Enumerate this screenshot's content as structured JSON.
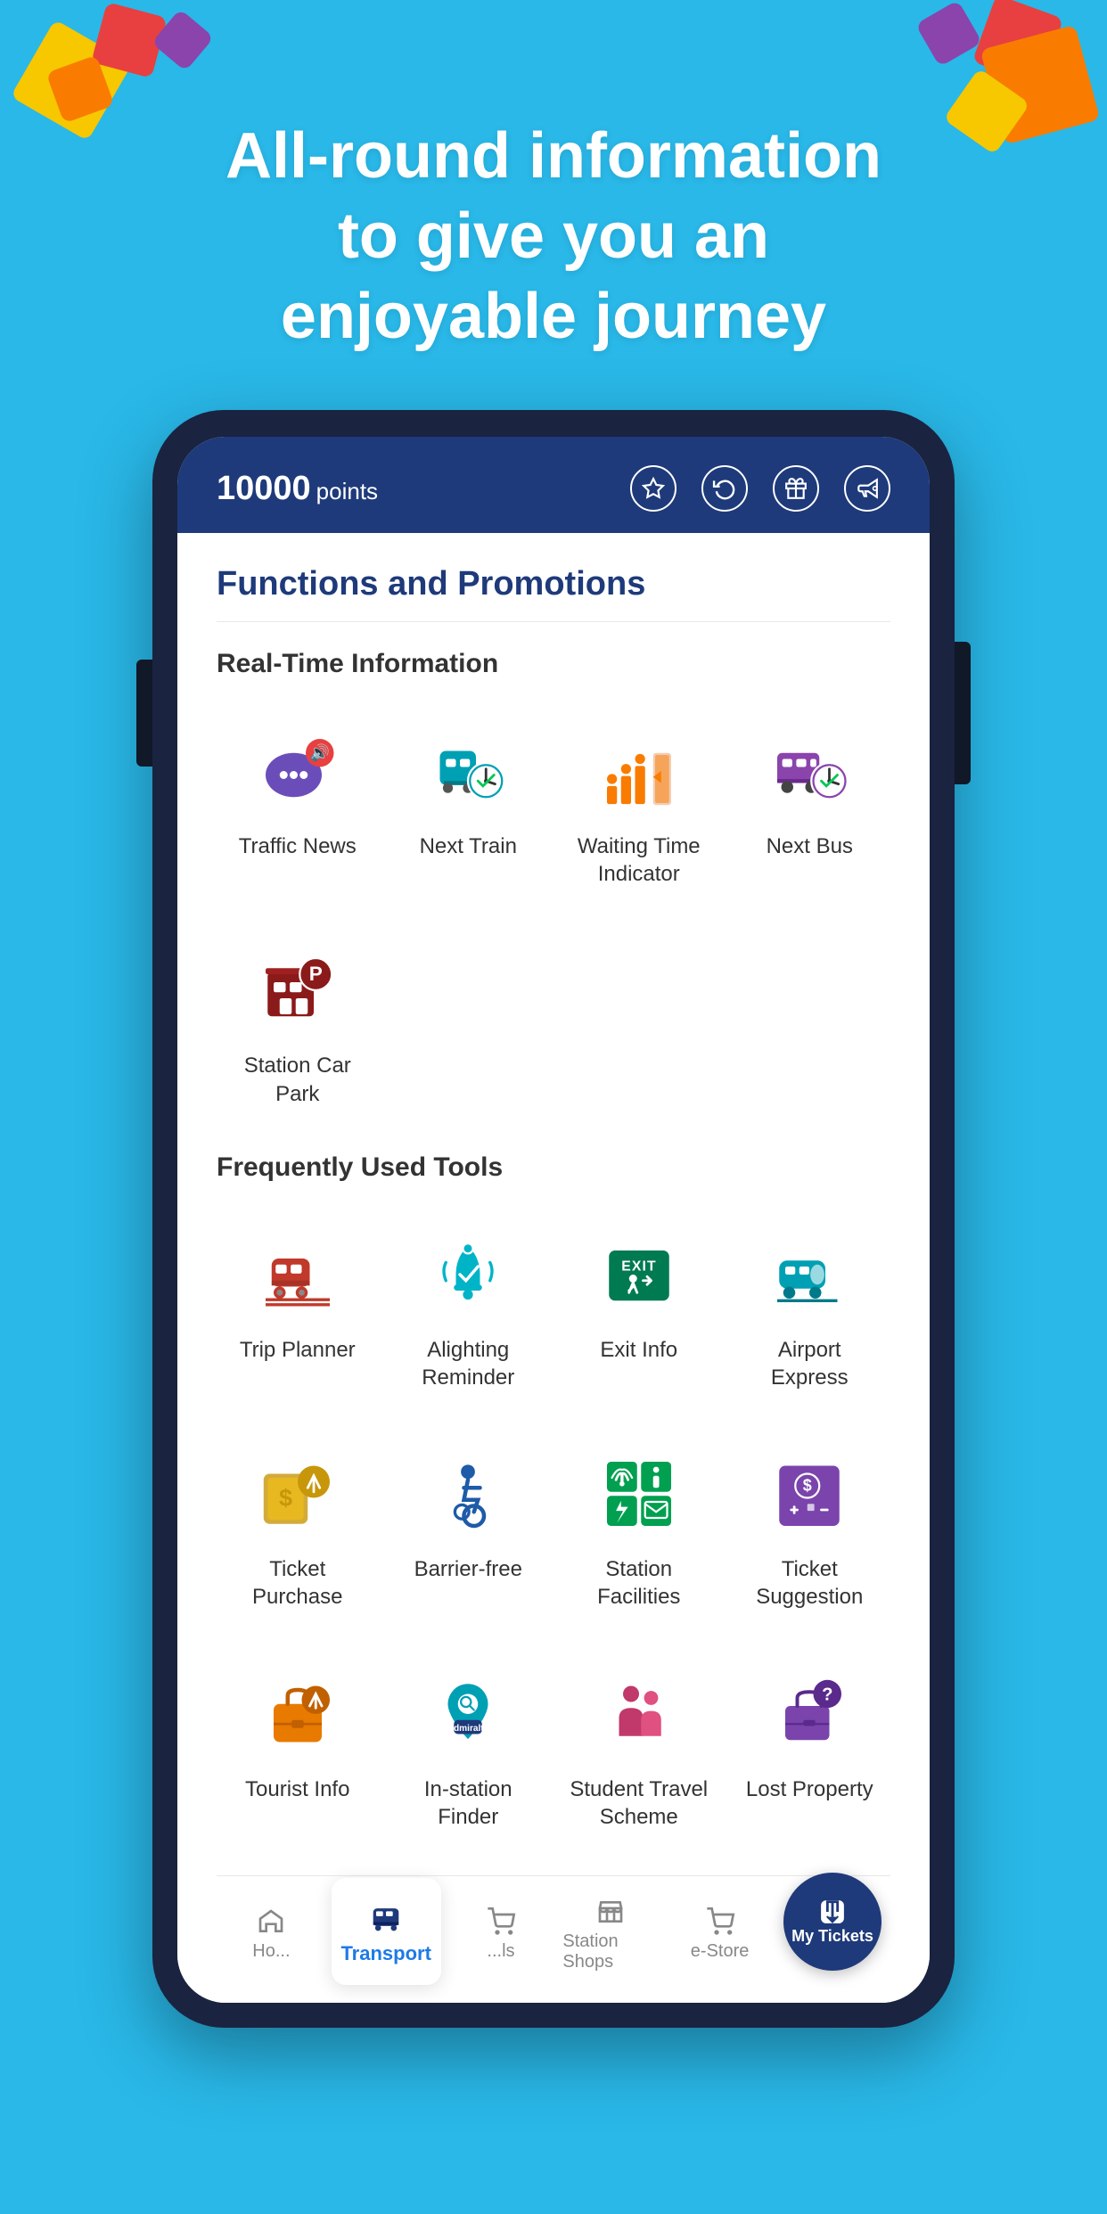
{
  "hero": {
    "line1": "All-round information",
    "line2": "to give you an",
    "line3": "enjoyable journey"
  },
  "phone": {
    "points": "10000",
    "points_label": "points",
    "header_icons": [
      "star",
      "refresh",
      "gift",
      "megaphone"
    ]
  },
  "functions": {
    "title": "Functions and Promotions",
    "sections": [
      {
        "label": "Real-Time Information",
        "items": [
          {
            "id": "traffic-news",
            "label": "Traffic News",
            "icon": "traffic"
          },
          {
            "id": "next-train",
            "label": "Next Train",
            "icon": "train"
          },
          {
            "id": "waiting-time",
            "label": "Waiting Time Indicator",
            "icon": "waiting"
          },
          {
            "id": "next-bus",
            "label": "Next Bus",
            "icon": "bus"
          }
        ]
      },
      {
        "label": "",
        "items": [
          {
            "id": "station-car-park",
            "label": "Station Car Park",
            "icon": "carpark"
          }
        ]
      },
      {
        "label": "Frequently Used Tools",
        "items": [
          {
            "id": "trip-planner",
            "label": "Trip Planner",
            "icon": "tripplanner"
          },
          {
            "id": "alighting-reminder",
            "label": "Alighting Reminder",
            "icon": "alighting"
          },
          {
            "id": "exit-info",
            "label": "Exit Info",
            "icon": "exit"
          },
          {
            "id": "airport-express",
            "label": "Airport Express",
            "icon": "airport"
          }
        ]
      },
      {
        "label": "",
        "items": [
          {
            "id": "ticket-purchase",
            "label": "Ticket Purchase",
            "icon": "ticket"
          },
          {
            "id": "barrier-free",
            "label": "Barrier-free",
            "icon": "barrier"
          },
          {
            "id": "station-facilities",
            "label": "Station Facilities",
            "icon": "facilities"
          },
          {
            "id": "ticket-suggestion",
            "label": "Ticket Suggestion",
            "icon": "suggestion"
          }
        ]
      },
      {
        "label": "",
        "items": [
          {
            "id": "tourist-info",
            "label": "Tourist Info",
            "icon": "tourist"
          },
          {
            "id": "instation-finder",
            "label": "In-station Finder",
            "icon": "finder"
          },
          {
            "id": "student-travel",
            "label": "Student Travel Scheme",
            "icon": "student"
          },
          {
            "id": "lost-property",
            "label": "Lost Property",
            "icon": "lost"
          }
        ]
      }
    ]
  },
  "bottom_nav": [
    {
      "id": "home",
      "label": "Ho...",
      "icon": "home"
    },
    {
      "id": "transport",
      "label": "Transport",
      "icon": "transport",
      "active": true
    },
    {
      "id": "deals",
      "label": "...ls",
      "icon": "deals"
    },
    {
      "id": "station-shops",
      "label": "Station Shops",
      "icon": "shops"
    },
    {
      "id": "e-store",
      "label": "e-Store",
      "icon": "estore"
    },
    {
      "id": "my-tickets",
      "label": "My Tickets",
      "icon": "mytickets"
    }
  ]
}
